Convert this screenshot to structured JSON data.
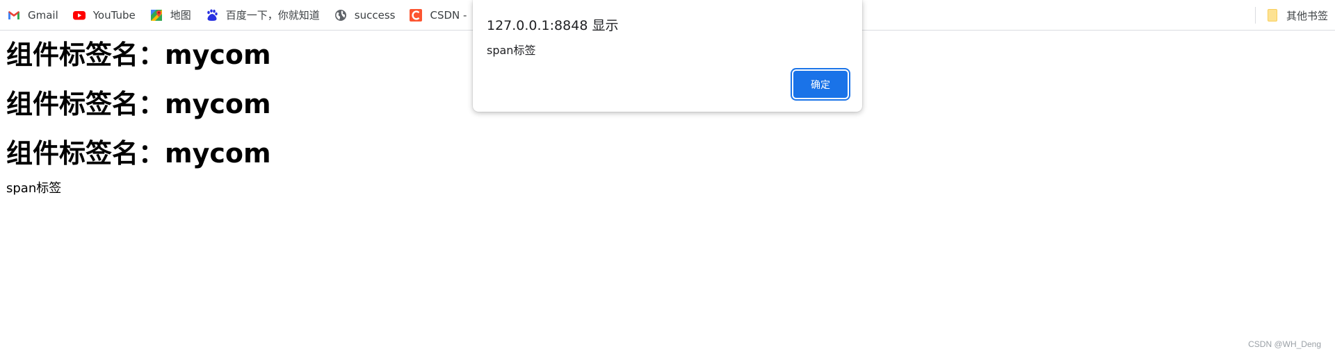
{
  "bookmarks": [
    {
      "label": "Gmail",
      "icon": "gmail-icon"
    },
    {
      "label": "YouTube",
      "icon": "youtube-icon"
    },
    {
      "label": "地图",
      "icon": "maps-icon"
    },
    {
      "label": "百度一下，你就知道",
      "icon": "baidu-icon"
    },
    {
      "label": "success",
      "icon": "globe-icon"
    },
    {
      "label": "CSDN - ",
      "icon": "csdn-icon"
    }
  ],
  "other_bookmarks": {
    "label": "其他书签",
    "icon": "folder-icon"
  },
  "page": {
    "headings": [
      "组件标签名：mycom",
      "组件标签名：mycom",
      "组件标签名：mycom"
    ],
    "span_text": "span标签"
  },
  "alert": {
    "title": "127.0.0.1:8848 显示",
    "message": "span标签",
    "ok_label": "确定"
  },
  "watermark": "CSDN @WH_Deng",
  "colors": {
    "accent": "#1a73e8",
    "youtube": "#ff0000",
    "csdn": "#fc5531"
  }
}
